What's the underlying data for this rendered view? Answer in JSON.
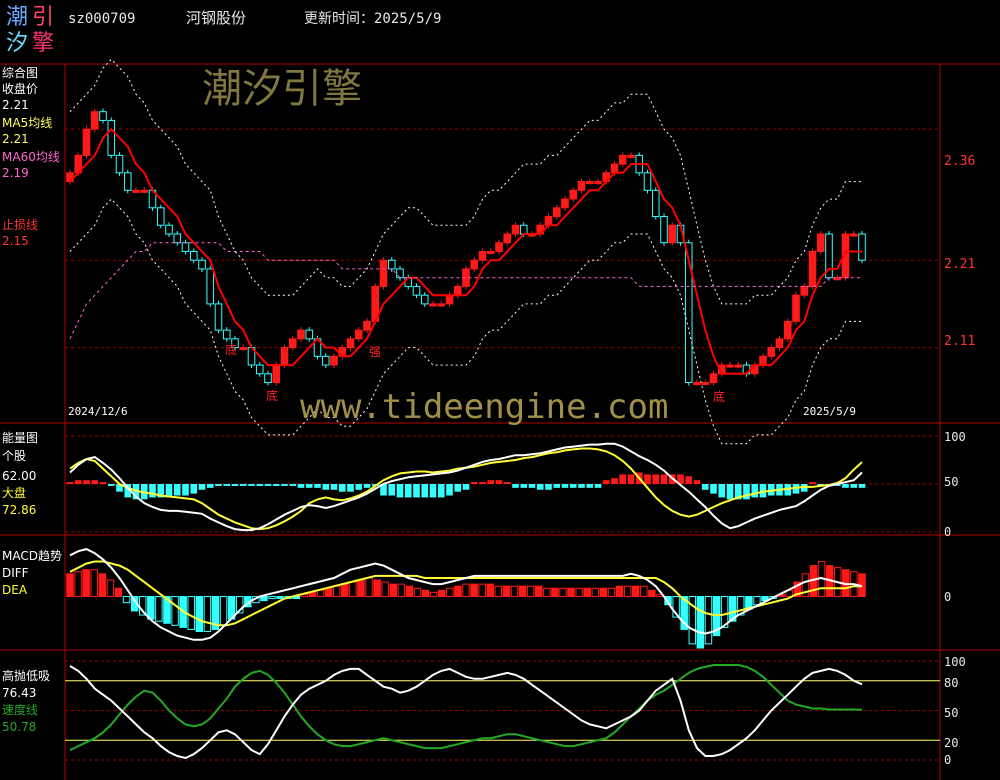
{
  "header": {
    "logo_chars": [
      "潮",
      "汐",
      "引",
      "擎"
    ],
    "stock_code": "sz000709",
    "stock_name": "河钢股份",
    "update_label": "更新时间：2025/5/9"
  },
  "watermarks": {
    "top": "潮汐引擎",
    "middle": "www.tideengine.com"
  },
  "colors": {
    "background": "#000000",
    "up": "#ff1a1a",
    "down": "#33ffff",
    "ma5": "#ffff66",
    "ma60": "#ff66cc",
    "ma_line": "#ff0000",
    "grid": "#990000",
    "white": "#ffffff",
    "yellow": "#ffff33",
    "green": "#22aa22",
    "axis_text": "#ff3333"
  },
  "panels": {
    "main": {
      "lines": [
        "综合图",
        "收盘价",
        "2.21",
        "MA5均线",
        "2.21",
        "MA60均线",
        "2.19",
        "",
        "止损线",
        "2.15"
      ],
      "price_ticks": [
        "2.36",
        "2.21",
        "2.11"
      ],
      "date_left": "2024/12/6",
      "date_right": "2025/5/9",
      "annotations": [
        "底",
        "底",
        "强",
        "底"
      ]
    },
    "energy": {
      "lines": [
        "能量图",
        "个股",
        "62.00",
        "大盘",
        "72.86"
      ],
      "ticks": [
        "100",
        "50",
        "0"
      ]
    },
    "macd": {
      "lines": [
        "MACD趋势",
        "DIFF",
        "DEA"
      ],
      "ticks": [
        "0"
      ]
    },
    "osc": {
      "lines": [
        "高抛低吸",
        "76.43",
        "速度线",
        "50.78"
      ],
      "ticks": [
        "100",
        "80",
        "50",
        "20",
        "0"
      ]
    }
  },
  "chart_data": [
    {
      "type": "candlestick",
      "y_axis_ticks": [
        2.36,
        2.21,
        2.11
      ],
      "dates": [
        "2024/12/6",
        "2025/5/9"
      ],
      "close": [
        2.31,
        2.33,
        2.36,
        2.38,
        2.37,
        2.33,
        2.31,
        2.29,
        2.29,
        2.29,
        2.27,
        2.25,
        2.24,
        2.23,
        2.22,
        2.21,
        2.2,
        2.16,
        2.13,
        2.12,
        2.11,
        2.11,
        2.09,
        2.08,
        2.07,
        2.09,
        2.11,
        2.12,
        2.13,
        2.12,
        2.1,
        2.09,
        2.1,
        2.11,
        2.12,
        2.13,
        2.14,
        2.18,
        2.21,
        2.2,
        2.19,
        2.18,
        2.17,
        2.16,
        2.16,
        2.16,
        2.17,
        2.18,
        2.2,
        2.21,
        2.22,
        2.22,
        2.23,
        2.24,
        2.25,
        2.24,
        2.24,
        2.25,
        2.26,
        2.27,
        2.28,
        2.29,
        2.3,
        2.3,
        2.3,
        2.31,
        2.32,
        2.33,
        2.33,
        2.31,
        2.29,
        2.26,
        2.23,
        2.25,
        2.23,
        2.07,
        2.07,
        2.07,
        2.08,
        2.09,
        2.09,
        2.09,
        2.08,
        2.09,
        2.1,
        2.11,
        2.12,
        2.14,
        2.17,
        2.18,
        2.22,
        2.24,
        2.19,
        2.19,
        2.24,
        2.24,
        2.21
      ],
      "ma5": [
        2.3,
        2.31,
        2.32,
        2.33,
        2.35,
        2.36,
        2.35,
        2.34,
        2.32,
        2.31,
        2.29,
        2.28,
        2.27,
        2.26,
        2.24,
        2.23,
        2.22,
        2.21,
        2.18,
        2.16,
        2.14,
        2.13,
        2.11,
        2.1,
        2.09,
        2.09,
        2.09,
        2.09,
        2.1,
        2.11,
        2.12,
        2.11,
        2.11,
        2.1,
        2.1,
        2.11,
        2.12,
        2.14,
        2.16,
        2.17,
        2.18,
        2.19,
        2.19,
        2.18,
        2.17,
        2.17,
        2.17,
        2.17,
        2.17,
        2.18,
        2.2,
        2.21,
        2.21,
        2.22,
        2.23,
        2.24,
        2.24,
        2.24,
        2.25,
        2.25,
        2.26,
        2.27,
        2.28,
        2.29,
        2.29,
        2.3,
        2.31,
        2.31,
        2.32,
        2.32,
        2.32,
        2.3,
        2.28,
        2.27,
        2.25,
        2.21,
        2.17,
        2.13,
        2.1,
        2.08,
        2.08,
        2.08,
        2.08,
        2.09,
        2.09,
        2.09,
        2.1,
        2.11,
        2.13,
        2.14,
        2.17,
        2.19,
        2.2,
        2.2,
        2.22,
        2.22,
        2.22
      ],
      "ma60": [
        2.12,
        2.14,
        2.16,
        2.17,
        2.18,
        2.19,
        2.2,
        2.21,
        2.22,
        2.22,
        2.23,
        2.23,
        2.23,
        2.23,
        2.23,
        2.23,
        2.23,
        2.23,
        2.23,
        2.22,
        2.22,
        2.22,
        2.22,
        2.22,
        2.21,
        2.21,
        2.21,
        2.21,
        2.21,
        2.21,
        2.21,
        2.21,
        2.21,
        2.2,
        2.2,
        2.2,
        2.2,
        2.2,
        2.2,
        2.2,
        2.19,
        2.19,
        2.19,
        2.19,
        2.19,
        2.19,
        2.19,
        2.19,
        2.19,
        2.19,
        2.19,
        2.19,
        2.19,
        2.19,
        2.19,
        2.19,
        2.19,
        2.19,
        2.19,
        2.19,
        2.19,
        2.19,
        2.19,
        2.19,
        2.19,
        2.19,
        2.19,
        2.19,
        2.19,
        2.18,
        2.18,
        2.18,
        2.18,
        2.18,
        2.18,
        2.18,
        2.18,
        2.18,
        2.18,
        2.18,
        2.18,
        2.18,
        2.18,
        2.18,
        2.18,
        2.18,
        2.18,
        2.18,
        2.18,
        2.18,
        2.18,
        2.18,
        2.19,
        2.19,
        2.19,
        2.19,
        2.19
      ]
    },
    {
      "type": "line",
      "name": "能量图",
      "y_range": [
        0,
        100
      ],
      "individual": [
        62,
        70,
        76,
        78,
        72,
        65,
        56,
        46,
        37,
        30,
        26,
        23,
        22,
        22,
        21,
        20,
        19,
        14,
        10,
        6,
        3,
        2,
        2,
        4,
        8,
        13,
        18,
        22,
        26,
        28,
        27,
        25,
        27,
        30,
        33,
        36,
        40,
        45,
        50,
        53,
        55,
        57,
        58,
        59,
        60,
        61,
        62,
        64,
        67,
        70,
        73,
        75,
        76,
        78,
        80,
        80,
        81,
        82,
        84,
        86,
        88,
        89,
        90,
        91,
        91,
        92,
        92,
        89,
        84,
        79,
        75,
        70,
        64,
        56,
        49,
        42,
        34,
        26,
        17,
        9,
        4,
        6,
        10,
        14,
        17,
        20,
        23,
        25,
        27,
        32,
        38,
        44,
        48,
        50,
        52,
        54,
        62
      ],
      "market": [
        66,
        72,
        76,
        74,
        66,
        58,
        50,
        46,
        43,
        41,
        40,
        38,
        37,
        36,
        35,
        34,
        30,
        24,
        18,
        14,
        10,
        7,
        4,
        3,
        4,
        7,
        11,
        16,
        22,
        30,
        34,
        36,
        34,
        33,
        35,
        38,
        42,
        48,
        54,
        58,
        61,
        62,
        63,
        63,
        62,
        63,
        64,
        66,
        67,
        68,
        70,
        72,
        73,
        74,
        75,
        77,
        78,
        80,
        82,
        83,
        85,
        86,
        87,
        87,
        86,
        84,
        80,
        74,
        66,
        56,
        46,
        36,
        28,
        22,
        18,
        16,
        18,
        22,
        26,
        30,
        33,
        36,
        38,
        40,
        42,
        43,
        44,
        45,
        46,
        47,
        47,
        48,
        49,
        51,
        56,
        65,
        72.86
      ],
      "bars": [
        2,
        4,
        4,
        4,
        2,
        -2,
        -8,
        -14,
        -16,
        -16,
        -14,
        -14,
        -14,
        -12,
        -12,
        -10,
        -6,
        -4,
        -2,
        -2,
        -2,
        -2,
        -2,
        -2,
        -2,
        -2,
        -2,
        -2,
        -4,
        -4,
        -4,
        -6,
        -6,
        -8,
        -8,
        -6,
        -4,
        -2,
        -12,
        -12,
        -14,
        -14,
        -14,
        -14,
        -14,
        -14,
        -12,
        -8,
        -6,
        2,
        2,
        4,
        4,
        2,
        -4,
        -4,
        -4,
        -6,
        -6,
        -4,
        -4,
        -4,
        -4,
        -4,
        -4,
        4,
        6,
        10,
        10,
        12,
        10,
        10,
        10,
        10,
        10,
        8,
        4,
        -6,
        -10,
        -14,
        -16,
        -16,
        -16,
        -14,
        -14,
        -12,
        -12,
        -12,
        -10,
        -8,
        2,
        -2,
        -2,
        -2,
        -4,
        -4,
        -4
      ]
    },
    {
      "type": "bar_line",
      "name": "MACD趋势",
      "macd": [
        22,
        24,
        26,
        26,
        22,
        16,
        8,
        -6,
        -14,
        -18,
        -22,
        -24,
        -26,
        -28,
        -30,
        -32,
        -34,
        -34,
        -32,
        -28,
        -22,
        -16,
        -10,
        -6,
        -4,
        -2,
        -2,
        -2,
        -2,
        2,
        4,
        6,
        8,
        10,
        12,
        14,
        16,
        18,
        16,
        14,
        12,
        12,
        10,
        8,
        6,
        4,
        6,
        8,
        10,
        12,
        12,
        12,
        12,
        10,
        10,
        10,
        10,
        10,
        10,
        8,
        8,
        8,
        8,
        8,
        8,
        8,
        8,
        8,
        10,
        10,
        10,
        10,
        6,
        2,
        -8,
        -20,
        -32,
        -46,
        -50,
        -46,
        -38,
        -30,
        -24,
        -18,
        -12,
        -8,
        -4,
        -2,
        2,
        6,
        14,
        22,
        30,
        34,
        30,
        28,
        26,
        24,
        22
      ],
      "diff": [
        40,
        44,
        46,
        42,
        36,
        28,
        18,
        6,
        -6,
        -16,
        -24,
        -30,
        -34,
        -38,
        -40,
        -42,
        -42,
        -40,
        -34,
        -26,
        -18,
        -10,
        -4,
        0,
        2,
        4,
        6,
        8,
        10,
        12,
        14,
        16,
        18,
        22,
        26,
        28,
        30,
        32,
        30,
        26,
        22,
        18,
        16,
        14,
        12,
        12,
        14,
        16,
        18,
        20,
        20,
        20,
        20,
        20,
        20,
        20,
        20,
        20,
        20,
        20,
        20,
        20,
        20,
        20,
        20,
        20,
        20,
        20,
        22,
        20,
        16,
        10,
        0,
        -12,
        -22,
        -30,
        -34,
        -36,
        -34,
        -30,
        -24,
        -18,
        -14,
        -10,
        -6,
        -2,
        2,
        6,
        10,
        14,
        16,
        18,
        16,
        14,
        12,
        12,
        10
      ],
      "dea": [
        24,
        28,
        32,
        34,
        34,
        32,
        30,
        26,
        20,
        14,
        8,
        2,
        -4,
        -10,
        -16,
        -20,
        -24,
        -26,
        -28,
        -28,
        -26,
        -22,
        -18,
        -14,
        -10,
        -6,
        -2,
        0,
        2,
        4,
        6,
        8,
        10,
        12,
        14,
        16,
        18,
        20,
        20,
        20,
        20,
        20,
        20,
        18,
        18,
        18,
        18,
        18,
        18,
        18,
        18,
        18,
        18,
        18,
        18,
        18,
        18,
        18,
        18,
        18,
        18,
        18,
        18,
        18,
        18,
        18,
        18,
        18,
        18,
        18,
        18,
        18,
        14,
        8,
        0,
        -6,
        -12,
        -16,
        -18,
        -18,
        -16,
        -14,
        -12,
        -10,
        -8,
        -6,
        -4,
        -2,
        2,
        4,
        6,
        8,
        8,
        8,
        8,
        10,
        10
      ],
      "y_range": [
        -50,
        50
      ]
    },
    {
      "type": "line",
      "name": "高抛低吸",
      "y_range": [
        0,
        100
      ],
      "white": [
        95,
        90,
        82,
        72,
        66,
        60,
        52,
        44,
        36,
        28,
        22,
        14,
        8,
        4,
        2,
        6,
        12,
        20,
        28,
        30,
        26,
        18,
        10,
        6,
        16,
        30,
        44,
        56,
        66,
        72,
        76,
        80,
        86,
        90,
        92,
        92,
        86,
        80,
        74,
        72,
        68,
        70,
        74,
        80,
        86,
        90,
        92,
        88,
        84,
        82,
        82,
        84,
        86,
        88,
        86,
        82,
        76,
        70,
        64,
        58,
        52,
        46,
        40,
        36,
        34,
        32,
        36,
        40,
        44,
        50,
        60,
        70,
        76,
        82,
        60,
        30,
        12,
        4,
        4,
        6,
        10,
        16,
        22,
        30,
        40,
        50,
        58,
        66,
        74,
        82,
        88,
        90,
        92,
        90,
        86,
        80,
        76.43
      ],
      "green": [
        10,
        14,
        18,
        22,
        28,
        36,
        46,
        56,
        64,
        70,
        68,
        60,
        50,
        42,
        36,
        34,
        36,
        42,
        52,
        62,
        74,
        82,
        88,
        90,
        86,
        78,
        68,
        56,
        44,
        34,
        26,
        20,
        16,
        14,
        14,
        16,
        18,
        20,
        22,
        20,
        18,
        16,
        14,
        12,
        12,
        12,
        14,
        16,
        18,
        20,
        22,
        22,
        24,
        26,
        26,
        24,
        22,
        20,
        18,
        16,
        14,
        14,
        16,
        18,
        20,
        22,
        28,
        36,
        44,
        52,
        60,
        66,
        70,
        76,
        82,
        88,
        92,
        94,
        96,
        96,
        96,
        96,
        94,
        90,
        84,
        76,
        68,
        60,
        56,
        54,
        52,
        52,
        51,
        51,
        51,
        51,
        50.78
      ]
    }
  ]
}
